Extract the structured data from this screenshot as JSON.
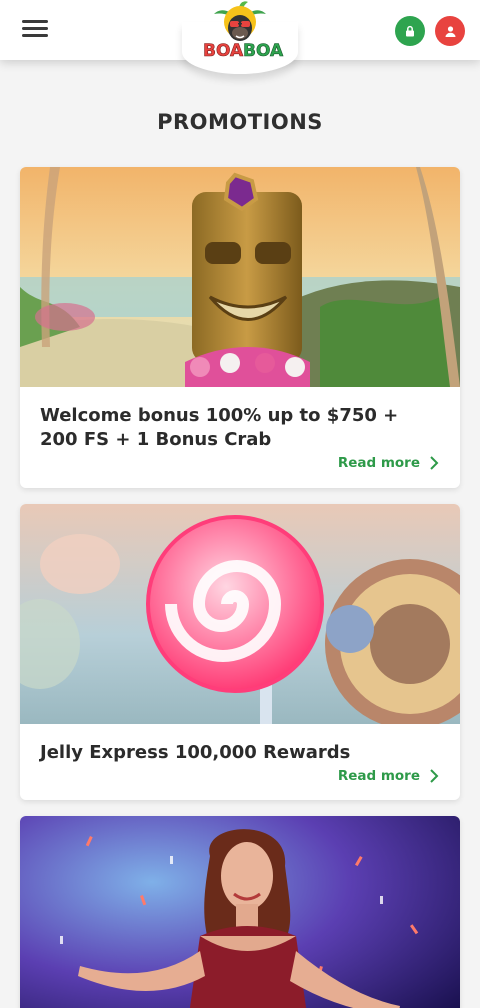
{
  "header": {
    "logo_text": "BOABOA",
    "menu_icon": "hamburger-icon",
    "login_icon": "lock-icon",
    "register_icon": "user-icon",
    "colors": {
      "login": "#2ea44f",
      "register": "#e8433f"
    }
  },
  "page": {
    "title": "PROMOTIONS"
  },
  "promotions": [
    {
      "title": "Welcome bonus 100% up to $750 + 200 FS + 1 Bonus Crab",
      "link": "Read more"
    },
    {
      "title": "Jelly Express 100,000 Rewards",
      "link": "Read more"
    },
    {
      "title": "",
      "link": ""
    }
  ],
  "colors": {
    "accent": "#2e9a49",
    "text": "#2b2b2b",
    "background": "#f4f4f4"
  }
}
